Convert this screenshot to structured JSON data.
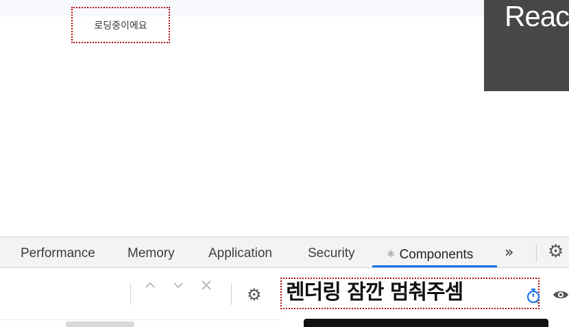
{
  "page": {
    "loading_text": "로딩중이에요",
    "dark_panel_text": "Reac"
  },
  "devtools": {
    "tabs": [
      {
        "label": "Performance"
      },
      {
        "label": "Memory"
      },
      {
        "label": "Application"
      },
      {
        "label": "Security"
      },
      {
        "label": "Components",
        "icon": "react-icon",
        "active": true
      }
    ],
    "more_tabs": "»",
    "settings_icon": "gear-icon",
    "accent_color": "#1a73e8"
  },
  "toolbar": {
    "up_icon": "chevron-up-icon",
    "down_icon": "chevron-down-icon",
    "clear_icon": "close-icon",
    "settings_icon": "gear-icon",
    "pause_banner": "렌더링 잠깐 멈춰주셈",
    "timer_icon": "stopwatch-icon",
    "eye_icon": "eye-icon"
  }
}
